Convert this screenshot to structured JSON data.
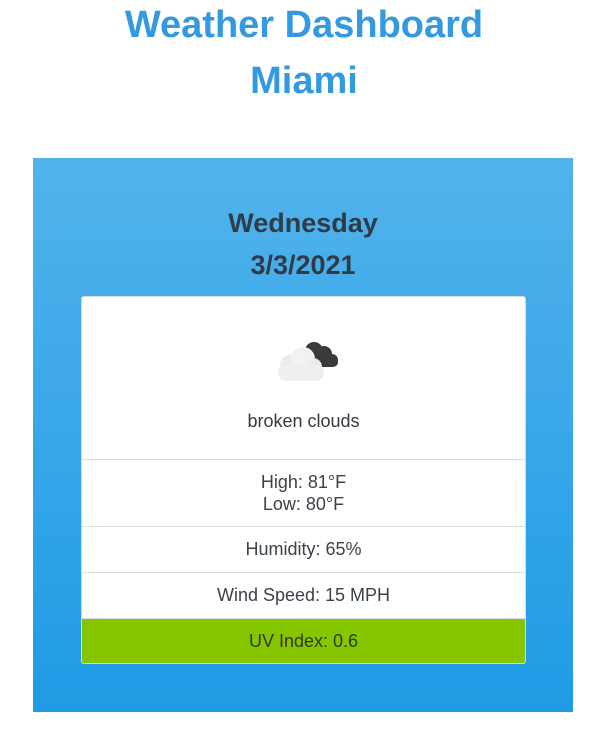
{
  "header": {
    "title_line1": "Weather Dashboard",
    "title_line2": "Miami"
  },
  "forecast": {
    "day": "Wednesday",
    "date": "3/3/2021",
    "icon": "broken-clouds-icon",
    "description": "broken clouds",
    "high": "High: 81°F",
    "low": "Low: 80°F",
    "humidity": "Humidity: 65%",
    "wind_speed": "Wind Speed: 15 MPH",
    "uv_index": "UV Index: 0.6"
  },
  "colors": {
    "title": "#3399e0",
    "panel_top": "#52b3ec",
    "panel_bottom": "#1f9be5",
    "uv_low": "#85c600"
  }
}
